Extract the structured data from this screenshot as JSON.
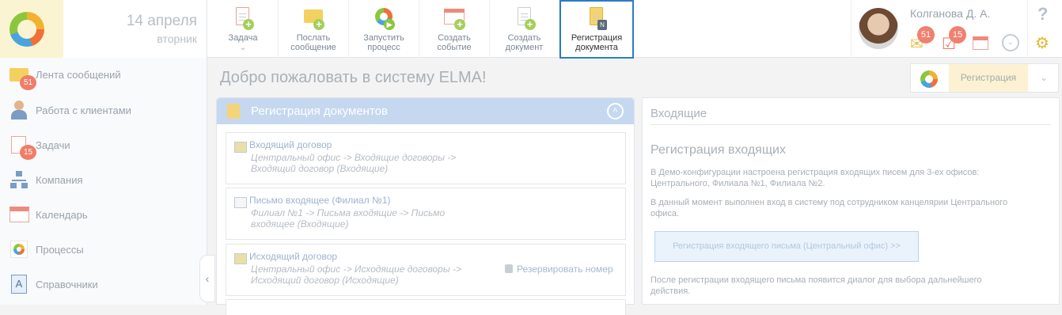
{
  "header": {
    "date_day": "14 апреля",
    "date_weekday": "вторник",
    "toolbar": [
      {
        "line1": "Задача",
        "line2": ""
      },
      {
        "line1": "Послать",
        "line2": "сообщение"
      },
      {
        "line1": "Запустить",
        "line2": "процесс"
      },
      {
        "line1": "Создать",
        "line2": "событие"
      },
      {
        "line1": "Создать",
        "line2": "документ"
      },
      {
        "line1": "Регистрация",
        "line2": "документа"
      }
    ],
    "user_name": "Колганова Д. А.",
    "messages_count": "51",
    "tasks_count": "15",
    "help_symbol": "?"
  },
  "sidebar": {
    "items": [
      {
        "label": "Лента сообщений",
        "badge": "51"
      },
      {
        "label": "Работа с клиентами",
        "badge": ""
      },
      {
        "label": "Задачи",
        "badge": "15"
      },
      {
        "label": "Компания",
        "badge": ""
      },
      {
        "label": "Календарь",
        "badge": ""
      },
      {
        "label": "Процессы",
        "badge": ""
      },
      {
        "label": "Справочники",
        "badge": ""
      }
    ]
  },
  "main": {
    "welcome": "Добро пожаловать в систему ELMA!",
    "reg_button": "Регистрация",
    "left_panel": {
      "title": "Регистрация документов",
      "cards": [
        {
          "title": "Входящий договор",
          "path_line1": "Центральный офис -> Входящие договоры ->",
          "path_line2": "Входящий договор (Входящие)",
          "reserve": ""
        },
        {
          "title": "Письмо входящее (Филиал №1)",
          "path_line1": "Филиал №1 -> Письма входящие -> Письмо",
          "path_line2": "входящее (Входящие)",
          "reserve": ""
        },
        {
          "title": "Исходящий договор",
          "path_line1": "Центральный офис -> Исходящие договоры ->",
          "path_line2": "Исходящий договор (Исходящие)",
          "reserve": "Резервировать номер"
        }
      ]
    },
    "right_panel": {
      "title": "Входящие",
      "subtitle": "Регистрация входящих",
      "para1_line1": "В Демо-конфигурации настроена регистрация входящих писем для 3-ех офисов:",
      "para1_line2": "Центрального, Филиала №1, Филиала №2.",
      "para2_line1": "В данный момент выполнен вход в систему под сотрудником канцелярии Центрального",
      "para2_line2": "офиса.",
      "button": "Регистрация входящего письма (Центральный офис) >>",
      "para3_line1": "После регистрации входящего письма появится диалог для выбора дальнейшего",
      "para3_line2": "действия."
    }
  },
  "colors": {
    "accent_blue": "#2c7cc4",
    "badge_red": "#ef7d68",
    "panel_header": "#c5d8ef",
    "highlight_yellow": "#fcf2d3"
  }
}
